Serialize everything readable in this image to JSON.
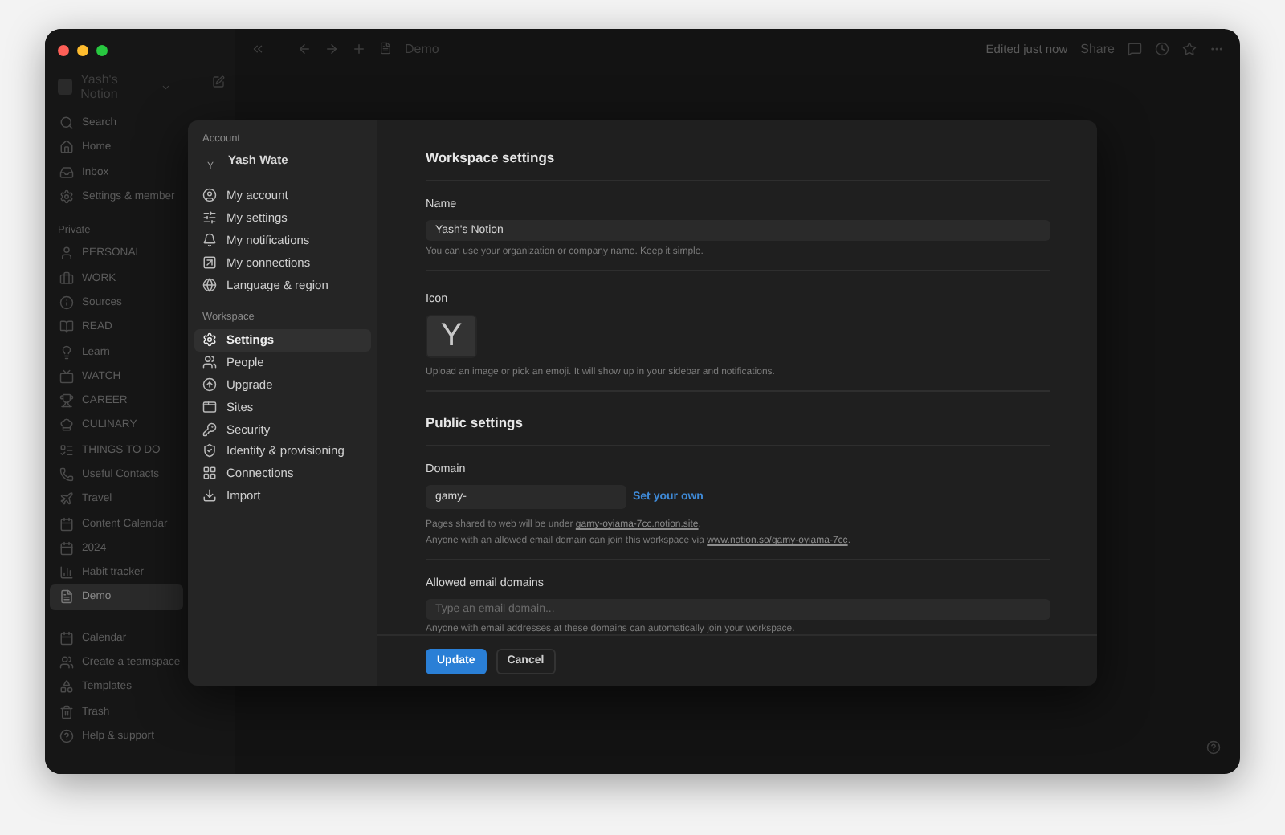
{
  "window": {
    "workspace": "Yash's Notion",
    "breadcrumb": "Demo",
    "edited": "Edited just now",
    "share": "Share"
  },
  "sidebar": {
    "top_items": [
      {
        "label": "Search"
      },
      {
        "label": "Home"
      },
      {
        "label": "Inbox"
      },
      {
        "label": "Settings & member"
      }
    ],
    "section": "Private",
    "pages": [
      {
        "label": "PERSONAL",
        "selected": false
      },
      {
        "label": "WORK",
        "selected": false
      },
      {
        "label": "Sources",
        "selected": false
      },
      {
        "label": "READ",
        "selected": false
      },
      {
        "label": "Learn",
        "selected": false
      },
      {
        "label": "WATCH",
        "selected": false
      },
      {
        "label": "CAREER",
        "selected": false
      },
      {
        "label": "CULINARY",
        "selected": false
      },
      {
        "label": "THINGS TO DO",
        "selected": false
      },
      {
        "label": "Useful Contacts",
        "selected": false
      },
      {
        "label": "Travel",
        "selected": false
      },
      {
        "label": "Content Calendar",
        "selected": false
      },
      {
        "label": "2024",
        "selected": false
      },
      {
        "label": "Habit tracker",
        "selected": false
      },
      {
        "label": "Demo",
        "selected": true
      }
    ],
    "bottom_items": [
      {
        "label": "Calendar"
      },
      {
        "label": "Create a teamspace"
      },
      {
        "label": "Templates"
      },
      {
        "label": "Trash"
      },
      {
        "label": "Help & support"
      }
    ]
  },
  "settings": {
    "nav": {
      "account_label": "Account",
      "user": {
        "initial": "Y",
        "name": "Yash Wate"
      },
      "account_items": [
        {
          "label": "My account",
          "selected": false
        },
        {
          "label": "My settings",
          "selected": false
        },
        {
          "label": "My notifications",
          "selected": false
        },
        {
          "label": "My connections",
          "selected": false
        },
        {
          "label": "Language & region",
          "selected": false
        }
      ],
      "workspace_label": "Workspace",
      "workspace_items": [
        {
          "label": "Settings",
          "selected": true
        },
        {
          "label": "People",
          "selected": false
        },
        {
          "label": "Upgrade",
          "selected": false
        },
        {
          "label": "Sites",
          "selected": false
        },
        {
          "label": "Security",
          "selected": false
        },
        {
          "label": "Identity & provisioning",
          "selected": false
        },
        {
          "label": "Connections",
          "selected": false
        },
        {
          "label": "Import",
          "selected": false
        }
      ]
    },
    "content": {
      "title": "Workspace settings",
      "name": {
        "label": "Name",
        "value": "Yash's Notion",
        "help": "You can use your organization or company name. Keep it simple."
      },
      "icon": {
        "label": "Icon",
        "letter": "Y",
        "help": "Upload an image or pick an emoji. It will show up in your sidebar and notifications."
      },
      "public_title": "Public settings",
      "domain": {
        "label": "Domain",
        "value": "gamy-",
        "link": "Set your own",
        "lines": [
          {
            "text": "Pages shared to web will be under",
            "link": "gamy-oyiama-7cc.notion.site",
            "after": "."
          },
          {
            "text": "Anyone with an allowed email domain can join this workspace via",
            "link": "www.notion.so/gamy-oyiama-7cc",
            "after": "."
          }
        ]
      },
      "email": {
        "label": "Allowed email domains",
        "placeholder": "Type an email domain...",
        "help": "Anyone with email addresses at these domains can automatically join your workspace."
      }
    },
    "buttons": [
      {
        "label": "Update",
        "kind": "primary"
      },
      {
        "label": "Cancel",
        "kind": "secondary"
      }
    ]
  }
}
